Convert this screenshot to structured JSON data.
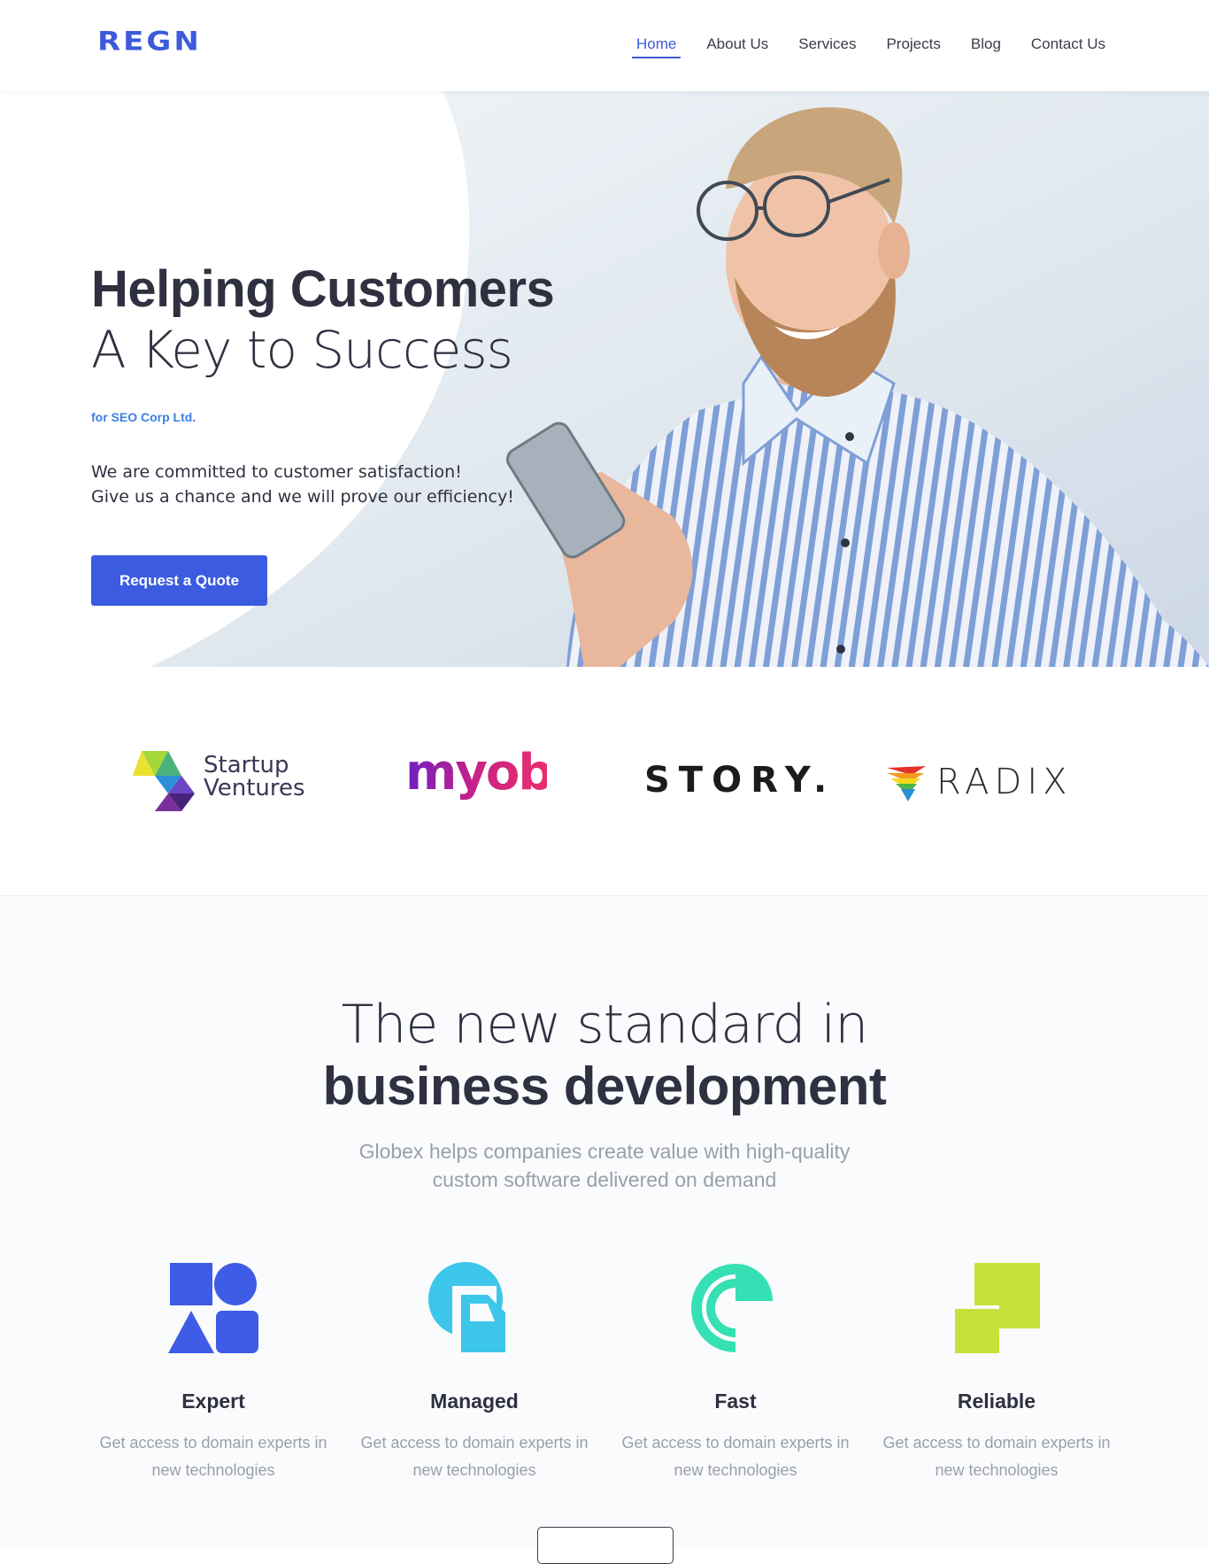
{
  "header": {
    "logo": "REGN",
    "nav": [
      {
        "label": "Home",
        "active": true
      },
      {
        "label": "About Us"
      },
      {
        "label": "Services"
      },
      {
        "label": "Projects"
      },
      {
        "label": "Blog"
      },
      {
        "label": "Contact Us"
      }
    ]
  },
  "hero": {
    "title_bold": "Helping Customers",
    "title_light": "A Key to Success",
    "subtitle": "for SEO Corp Ltd.",
    "text_line_1": "We are committed to customer satisfaction!",
    "text_line_2": "Give us a chance and we will prove our efficiency!",
    "cta_label": "Request a Quote"
  },
  "partners": [
    {
      "name": "Startup Ventures",
      "line1": "Startup",
      "line2": "Ventures"
    },
    {
      "name": "myob"
    },
    {
      "name": "STORY."
    },
    {
      "name": "RADIX"
    }
  ],
  "features_section": {
    "title_light": "The new standard in",
    "title_bold": "business development",
    "desc_line_1": "Globex helps companies create value with high-quality",
    "desc_line_2": "custom software delivered on demand",
    "items": [
      {
        "icon": "shapes-icon",
        "title": "Expert",
        "text": "Get access to domain experts in new technologies",
        "color": "#3f5ce6"
      },
      {
        "icon": "managed-icon",
        "title": "Managed",
        "text": "Get access to domain experts in new technologies",
        "color": "#3cc6ea"
      },
      {
        "icon": "fast-icon",
        "title": "Fast",
        "text": "Get access to domain experts in new technologies",
        "color": "#34e0b4"
      },
      {
        "icon": "reliable-icon",
        "title": "Reliable",
        "text": "Get access to domain experts in new technologies",
        "color": "#c8e03a"
      }
    ]
  },
  "colors": {
    "brand": "#3b5bdb",
    "cta": "#3b5be0",
    "accent_blue": "#3b80e3"
  }
}
